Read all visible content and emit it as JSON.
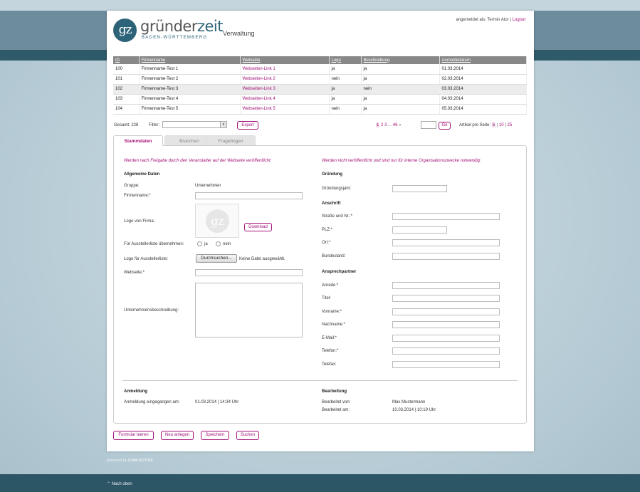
{
  "header": {
    "logo_prefix": "gz",
    "logo_word_main": "gründer",
    "logo_word_accent": "zeit",
    "logo_sub": "BADEN-WÜRTTEMBERG",
    "section": "Verwaltung",
    "logged_in_text": "angemeldet als: Termin Ator",
    "separator": "|",
    "logout": "Logout"
  },
  "table": {
    "columns": [
      "ID",
      "Firmenname",
      "Webseite",
      "Logo",
      "Beschreibung",
      "Anmeldedatum"
    ],
    "rows": [
      {
        "id": "100",
        "name": "Firmenname-Test 1",
        "web": "Webseiten-Link 1",
        "logo": "ja",
        "desc": "ja",
        "date": "01.03.2014"
      },
      {
        "id": "101",
        "name": "Firmenname-Test 2",
        "web": "Webseiten-Link 2",
        "logo": "nein",
        "desc": "ja",
        "date": "02.03.2014"
      },
      {
        "id": "102",
        "name": "Firmenname-Test 3",
        "web": "Webseiten-Link 3",
        "logo": "ja",
        "desc": "nein",
        "date": "03.03.2014"
      },
      {
        "id": "103",
        "name": "Firmenname-Test 4",
        "web": "Webseiten-Link 4",
        "logo": "ja",
        "desc": "ja",
        "date": "04.03.2014"
      },
      {
        "id": "104",
        "name": "Firmenname-Test 5",
        "web": "Webseiten-Link 5",
        "logo": "nein",
        "desc": "ja",
        "date": "05.03.2014"
      }
    ]
  },
  "toolbar": {
    "total": "Gesamt: 228",
    "filter_label": "Filter:",
    "filter_value": "",
    "export": "Export",
    "pages": [
      "1",
      "2",
      "3",
      "...",
      "46"
    ],
    "next": "»",
    "go": "Go",
    "per_page_label": "Artikel pro Seite:",
    "per_page": [
      "5",
      "10",
      "25"
    ]
  },
  "tabs": [
    "Stammdaten",
    "Branchen",
    "Fragebogen"
  ],
  "left": {
    "hint": "Werden nach Freigabe durch den Veranstalter auf der Webseite veröffentlicht:",
    "heading": "Allgemeine Daten",
    "group_label": "Gruppe:",
    "group_value": "Unternehmen",
    "company_label": "Firmenname:*",
    "logo_label": "Logo von Firma:",
    "logo_placeholder": "gz",
    "download": "Download",
    "exhibitor_label": "Für Ausstellerliste übernehmen:",
    "yes": "ja",
    "no": "nein",
    "exhibitor_logo_label": "Logo für Ausstellerliste:",
    "browse": "Durchsuchen...",
    "no_file": "Keine Datei ausgewählt.",
    "website_label": "Webseite:*",
    "description_label": "Unternehmensbeschreibung:",
    "registration_heading": "Anmeldung",
    "received_label": "Anmeldung eingegangen am:",
    "received_value": "01.03.2014 | 14:34 Uhr"
  },
  "right": {
    "hint": "Werden nicht veröffentlicht und sind nur für interne Organisationszwecke notwendig:",
    "founding_heading": "Gründung",
    "founding_year_label": "Gründungsjahr:",
    "address_heading": "Anschrift",
    "street_label": "Straße und Nr.:*",
    "zip_label": "PLZ:*",
    "city_label": "Ort:*",
    "state_label": "Bundesland:",
    "contact_heading": "Ansprechpartner",
    "salutation_label": "Anrede:*",
    "title_label": "Titel:",
    "firstname_label": "Vorname:*",
    "lastname_label": "Nachname:*",
    "email_label": "E-Mail:*",
    "phone_label": "Telefon:*",
    "fax_label": "Telefax:",
    "edit_heading": "Bearbeitung",
    "edited_by_label": "Bearbeitet von:",
    "edited_by_value": "Max Mustermann",
    "edited_at_label": "Bearbeitet am:",
    "edited_at_value": "10.03.2014 | 10:19 Uhr"
  },
  "actions": {
    "reset": "Formular leeren",
    "new": "Neu anlegen",
    "save": "Speichern",
    "search": "Suchen"
  },
  "footer": {
    "powered": "powered by",
    "company": "COM-ACTIVE",
    "back_to_top": "Nach oben",
    "arrow": "⌃"
  },
  "colors": {
    "accent": "#a4117a",
    "brand": "#2d6378",
    "stripe": "#2f5a69"
  }
}
